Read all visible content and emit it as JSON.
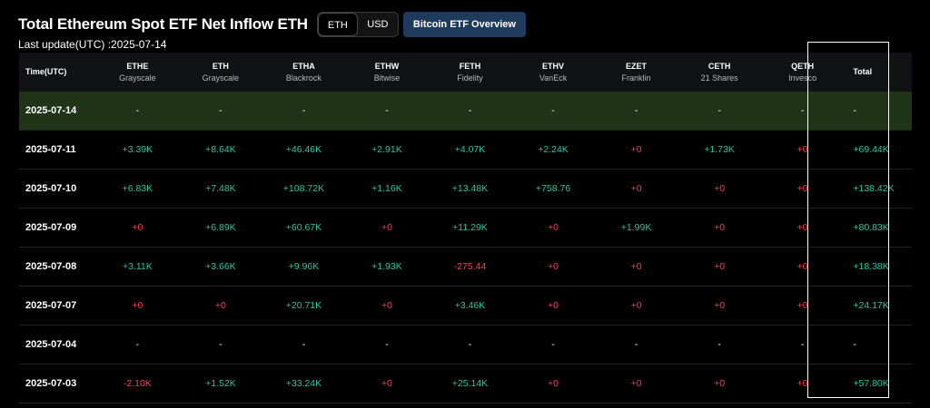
{
  "header": {
    "title": "Total Ethereum Spot ETF Net Inflow ETH",
    "units": [
      "ETH",
      "USD"
    ],
    "active_unit": "ETH",
    "overview_button": "Bitcoin ETF Overview",
    "last_update": "Last update(UTC) :2025-07-14"
  },
  "colors": {
    "positive": "#2ec4a0",
    "negative": "#ff3b4f",
    "highlight_row": "#203418",
    "button": "#1f3b5c"
  },
  "table": {
    "time_header": "Time(UTC)",
    "columns": [
      {
        "ticker": "ETHE",
        "issuer": "Grayscale"
      },
      {
        "ticker": "ETH",
        "issuer": "Grayscale"
      },
      {
        "ticker": "ETHA",
        "issuer": "Blackrock"
      },
      {
        "ticker": "ETHW",
        "issuer": "Bitwise"
      },
      {
        "ticker": "FETH",
        "issuer": "Fidelity"
      },
      {
        "ticker": "ETHV",
        "issuer": "VanEck"
      },
      {
        "ticker": "EZET",
        "issuer": "Franklin"
      },
      {
        "ticker": "CETH",
        "issuer": "21 Shares"
      },
      {
        "ticker": "QETH",
        "issuer": "Invesco"
      }
    ],
    "total_header": "Total",
    "rows": [
      {
        "date": "2025-07-14",
        "values": [
          "-",
          "-",
          "-",
          "-",
          "-",
          "-",
          "-",
          "-",
          "-"
        ],
        "total": "-"
      },
      {
        "date": "2025-07-11",
        "values": [
          "+3.39K",
          "+8.64K",
          "+46.46K",
          "+2.91K",
          "+4.07K",
          "+2.24K",
          "+0",
          "+1.73K",
          "+0"
        ],
        "total": "+69.44K"
      },
      {
        "date": "2025-07-10",
        "values": [
          "+6.83K",
          "+7.48K",
          "+108.72K",
          "+1.16K",
          "+13.48K",
          "+758.76",
          "+0",
          "+0",
          "+0"
        ],
        "total": "+138.42K"
      },
      {
        "date": "2025-07-09",
        "values": [
          "+0",
          "+6.89K",
          "+60.67K",
          "+0",
          "+11.29K",
          "+0",
          "+1.99K",
          "+0",
          "+0"
        ],
        "total": "+80.83K"
      },
      {
        "date": "2025-07-08",
        "values": [
          "+3.11K",
          "+3.66K",
          "+9.96K",
          "+1.93K",
          "-275.44",
          "+0",
          "+0",
          "+0",
          "+0"
        ],
        "total": "+18.38K"
      },
      {
        "date": "2025-07-07",
        "values": [
          "+0",
          "+0",
          "+20.71K",
          "+0",
          "+3.46K",
          "+0",
          "+0",
          "+0",
          "+0"
        ],
        "total": "+24.17K"
      },
      {
        "date": "2025-07-04",
        "values": [
          "-",
          "-",
          "-",
          "-",
          "-",
          "-",
          "-",
          "-",
          "-"
        ],
        "total": "-"
      },
      {
        "date": "2025-07-03",
        "values": [
          "-2.10K",
          "+1.52K",
          "+33.24K",
          "+0",
          "+25.14K",
          "+0",
          "+0",
          "+0",
          "+0"
        ],
        "total": "+57.80K"
      }
    ]
  }
}
